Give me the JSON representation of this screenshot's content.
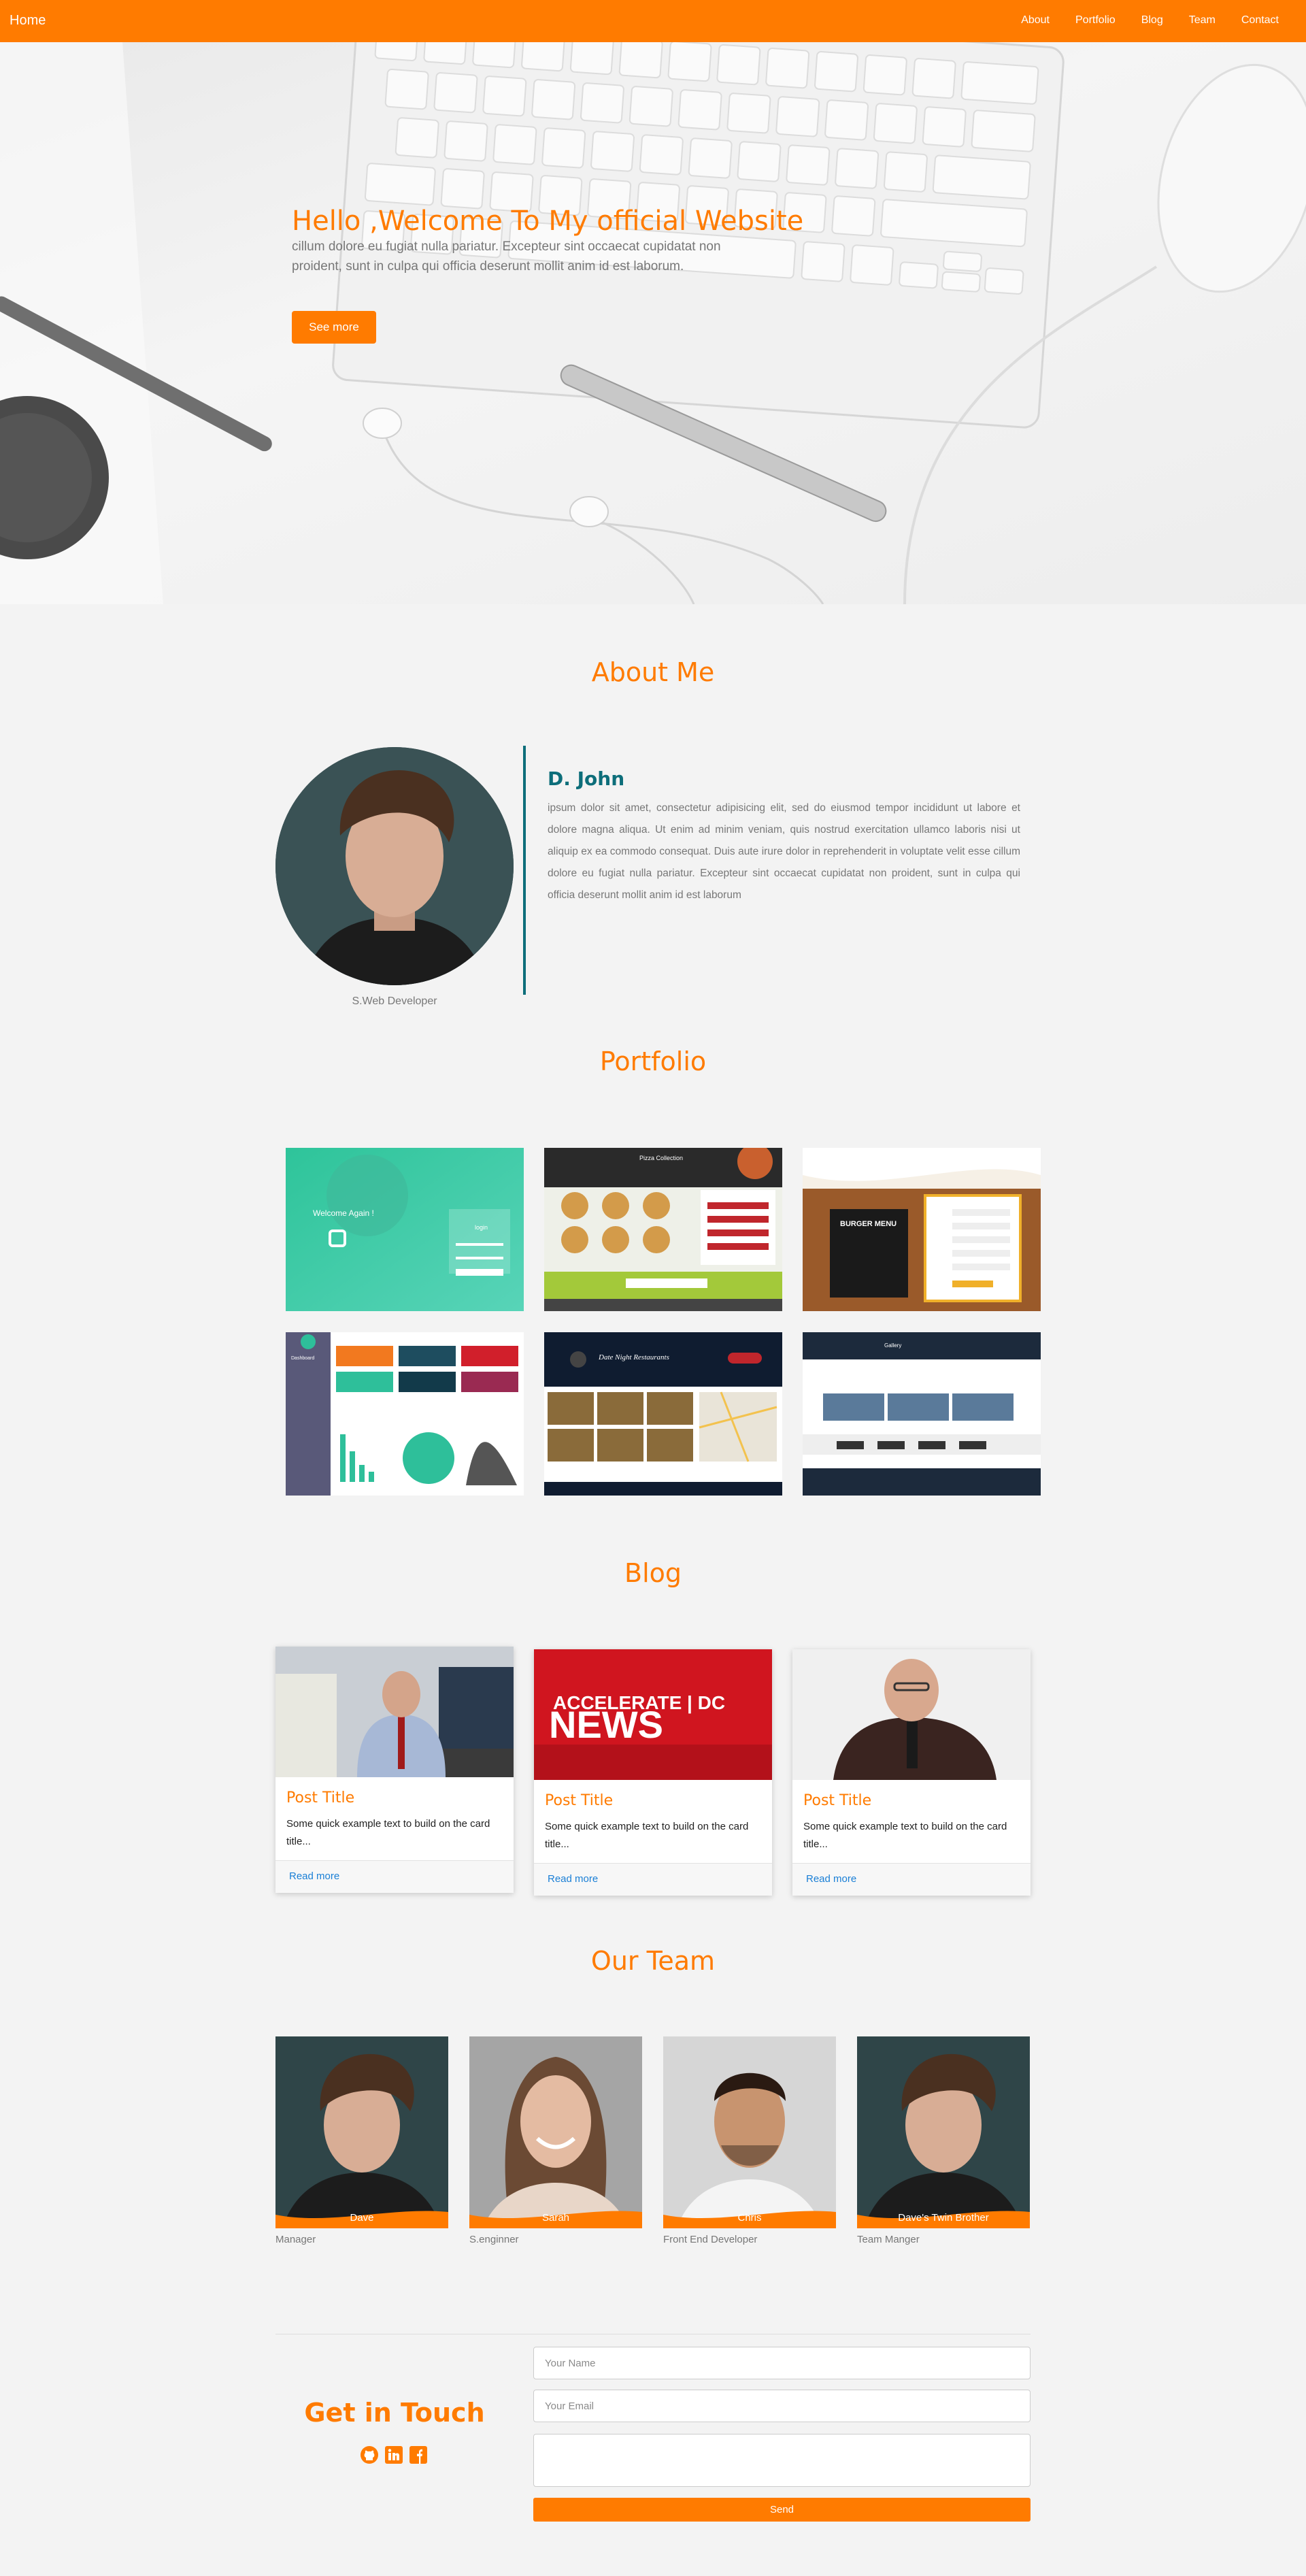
{
  "colors": {
    "accent": "#ff7b00",
    "teal": "#0d6e7a",
    "link": "#1a7fd6",
    "background": "#f3f3f3"
  },
  "nav": {
    "brand": "Home",
    "links": [
      "About",
      "Portfolio",
      "Blog",
      "Team",
      "Contact"
    ]
  },
  "hero": {
    "title": "Hello ,Welcome To My official Website",
    "subtitle": "cillum dolore eu fugiat nulla pariatur. Excepteur sint occaecat cupidatat non proident, sunt in culpa qui officia deserunt mollit anim id est laborum.",
    "button": "See more"
  },
  "about": {
    "heading": "About Me",
    "name": "D. John",
    "caption": "S.Web Developer",
    "text": "ipsum dolor sit amet, consectetur adipisicing elit, sed do eiusmod tempor incididunt ut labore et dolore magna aliqua. Ut enim ad minim veniam, quis nostrud exercitation ullamco laboris nisi ut aliquip ex ea commodo consequat. Duis aute irure dolor in reprehenderit in voluptate velit esse cillum dolore eu fugiat nulla pariatur. Excepteur sint occaecat cupidatat non proident, sunt in culpa qui officia deserunt mollit anim id est laborum"
  },
  "portfolio": {
    "heading": "Portfolio",
    "items": [
      {
        "thumb_text": "Welcome Again !",
        "thumb_sub": "login"
      },
      {
        "thumb_text": "Pizza Collection"
      },
      {
        "thumb_text": "BURGER MENU"
      },
      {
        "thumb_text": "Dashboard"
      },
      {
        "thumb_text": "Date Night Restaurants"
      },
      {
        "thumb_text": "Gallery"
      }
    ]
  },
  "blog": {
    "heading": "Blog",
    "posts": [
      {
        "title": "Post Title",
        "text": "Some quick example text to build on the card title...",
        "link": "Read more"
      },
      {
        "title": "Post Title",
        "text": "Some quick example text to build on the card title...",
        "link": "Read more",
        "image_text_top": "ACCELERATE | DC",
        "image_text_main": "NEWS"
      },
      {
        "title": "Post Title",
        "text": "Some quick example text to build on the card title...",
        "link": "Read more"
      }
    ]
  },
  "team": {
    "heading": "Our Team",
    "members": [
      {
        "name": "Dave",
        "role": "Manager"
      },
      {
        "name": "Sarah",
        "role": "S.enginner"
      },
      {
        "name": "Chris",
        "role": "Front End Developer"
      },
      {
        "name": "Dave's Twin Brother",
        "role": "Team Manger"
      }
    ]
  },
  "contact": {
    "heading": "Get in Touch",
    "social_icons": [
      "github-icon",
      "linkedin-icon",
      "facebook-icon"
    ],
    "name_placeholder": "Your Name",
    "email_placeholder": "Your Email",
    "message_placeholder": "",
    "send": "Send"
  }
}
